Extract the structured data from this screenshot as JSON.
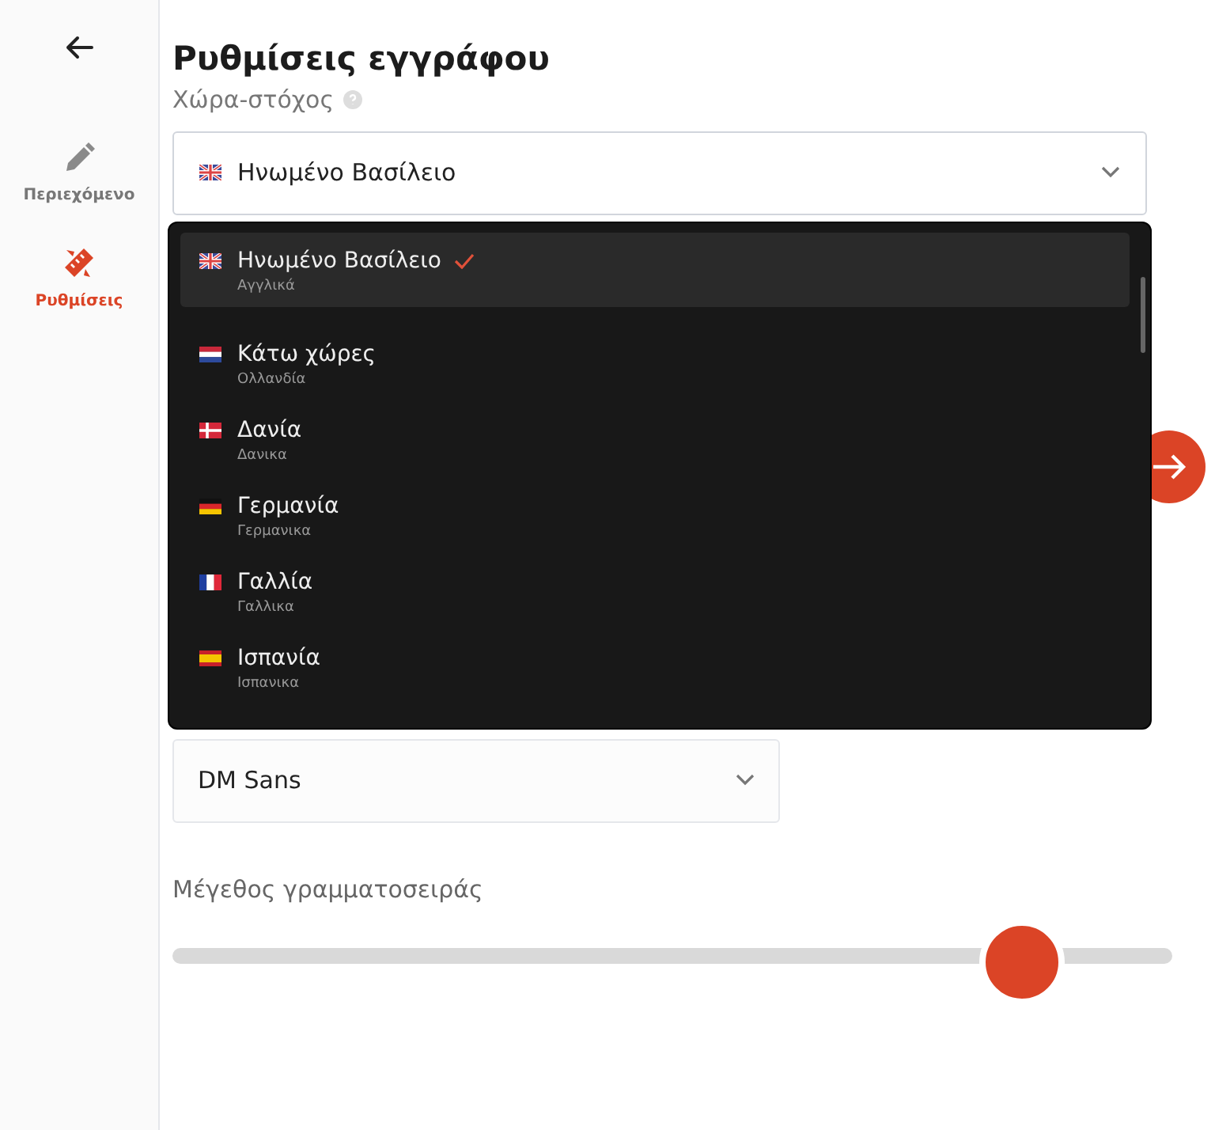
{
  "sidebar": {
    "items": [
      {
        "label": "Περιεχόμενο",
        "selected": false,
        "kind": "pencil"
      },
      {
        "label": "Ρυθμίσεις",
        "selected": true,
        "kind": "tools"
      }
    ]
  },
  "title": "Ρυθμίσεις εγγράφου",
  "target_country": {
    "label": "Χώρα-στόχος",
    "value": "Ηνωμένο Βασίλειο",
    "kind": "uk"
  },
  "dropdown": {
    "options": [
      {
        "label": "Ηνωμένο Βασίλειο",
        "sublabel": "Αγγλικά",
        "kind": "uk",
        "selected": true
      },
      {
        "label": "Κάτω χώρες",
        "sublabel": "Ολλανδία",
        "kind": "nl",
        "selected": false
      },
      {
        "label": "Δανία",
        "sublabel": "Δανικα",
        "kind": "dk",
        "selected": false
      },
      {
        "label": "Γερμανία",
        "sublabel": "Γερμανικα",
        "kind": "de",
        "selected": false
      },
      {
        "label": "Γαλλία",
        "sublabel": "Γαλλικα",
        "kind": "fr",
        "selected": false
      },
      {
        "label": "Ισπανία",
        "sublabel": "Ισπανικα",
        "kind": "es",
        "selected": false
      }
    ]
  },
  "font": {
    "value": "DM Sans"
  },
  "font_size": {
    "label": "Μέγεθος γραμματοσειράς",
    "level": 0.85
  }
}
